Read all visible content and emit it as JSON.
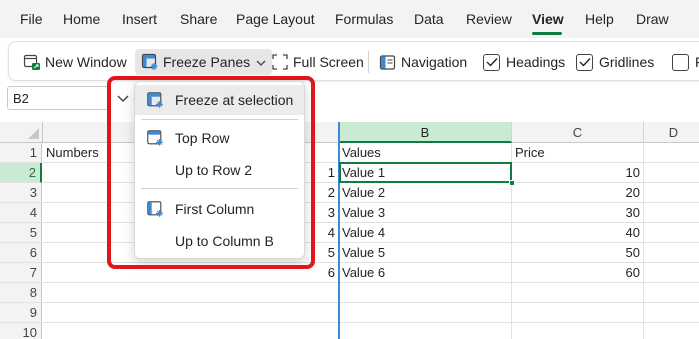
{
  "menu": {
    "tabs": [
      "File",
      "Home",
      "Insert",
      "Share",
      "Page Layout",
      "Formulas",
      "Data",
      "Review",
      "View",
      "Help",
      "Draw"
    ],
    "active_tab": "View"
  },
  "ribbon": {
    "new_window": "New Window",
    "freeze_panes": "Freeze Panes",
    "full_screen": "Full Screen",
    "navigation": "Navigation",
    "headings": "Headings",
    "gridlines": "Gridlines",
    "truncated": "F",
    "headings_checked": true,
    "gridlines_checked": true
  },
  "formula_bar": {
    "name_box": "B2"
  },
  "dropdown": {
    "freeze_at_selection": "Freeze at selection",
    "top_row": "Top Row",
    "up_to_row_2": "Up to Row 2",
    "first_column": "First Column",
    "up_to_column_b": "Up to Column B"
  },
  "grid": {
    "columns": [
      "B",
      "C",
      "D"
    ],
    "rows": [
      "1",
      "2",
      "3",
      "4",
      "5",
      "6",
      "7",
      "8",
      "9",
      "10"
    ],
    "header_row": {
      "a": "Numbers",
      "b": "Values",
      "c": "Price"
    },
    "data": [
      {
        "a": "1",
        "b": "Value 1",
        "c": "10"
      },
      {
        "a": "2",
        "b": "Value 2",
        "c": "20"
      },
      {
        "a": "3",
        "b": "Value 3",
        "c": "30"
      },
      {
        "a": "4",
        "b": "Value 4",
        "c": "40"
      },
      {
        "a": "5",
        "b": "Value 5",
        "c": "50"
      },
      {
        "a": "6",
        "b": "Value 6",
        "c": "60"
      }
    ]
  },
  "colors": {
    "accent": "#107c41",
    "freeze_line": "#3b8ad8",
    "highlight_box": "#e0161b"
  }
}
